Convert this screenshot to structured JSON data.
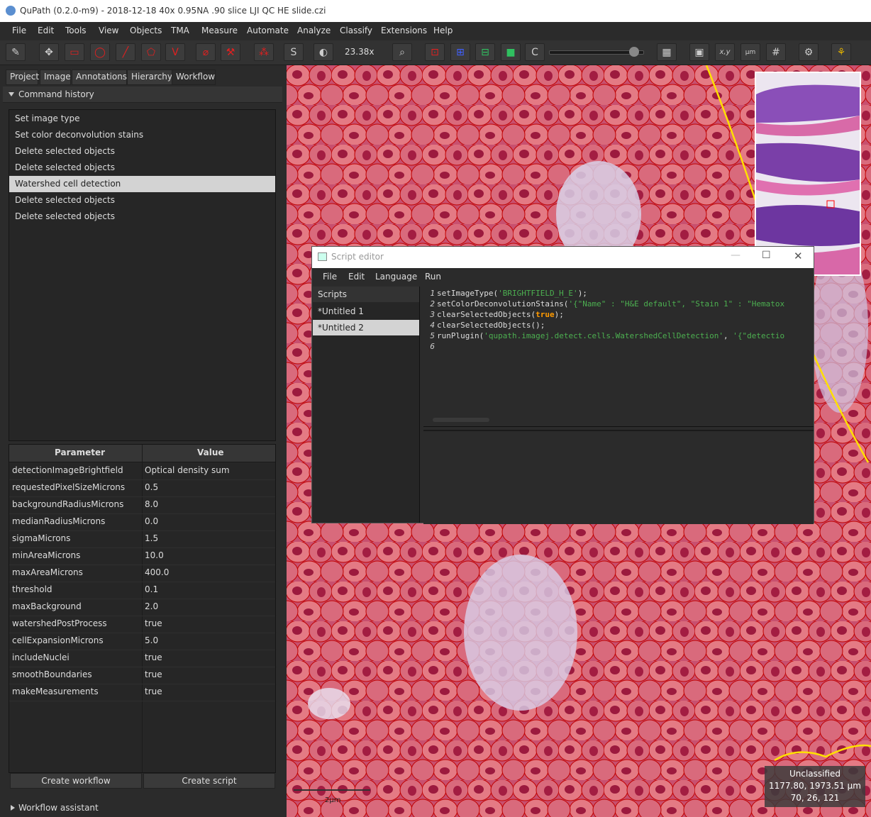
{
  "window": {
    "title": "QuPath (0.2.0-m9) - 2018-12-18 40x 0.95NA .90 slice LJI QC HE slide.czi"
  },
  "menu": [
    "File",
    "Edit",
    "Tools",
    "View",
    "Objects",
    "TMA",
    "Measure",
    "Automate",
    "Analyze",
    "Classify",
    "Extensions",
    "Help"
  ],
  "toolbar": {
    "zoom": "23.38x",
    "s_label": "S",
    "c_label": "C",
    "xy_label": "x,y",
    "um_label": "µm"
  },
  "tabs": [
    "Project",
    "Image",
    "Annotations",
    "Hierarchy",
    "Workflow"
  ],
  "command_history": {
    "label": "Command history",
    "items": [
      "Set image type",
      "Set color deconvolution stains",
      "Delete selected objects",
      "Delete selected objects",
      "Watershed cell detection",
      "Delete selected objects",
      "Delete selected objects"
    ],
    "selected_index": 4
  },
  "params": {
    "header_param": "Parameter",
    "header_value": "Value",
    "rows": [
      [
        "detectionImageBrightfield",
        "Optical density sum"
      ],
      [
        "requestedPixelSizeMicrons",
        "0.5"
      ],
      [
        "backgroundRadiusMicrons",
        "8.0"
      ],
      [
        "medianRadiusMicrons",
        "0.0"
      ],
      [
        "sigmaMicrons",
        "1.5"
      ],
      [
        "minAreaMicrons",
        "10.0"
      ],
      [
        "maxAreaMicrons",
        "400.0"
      ],
      [
        "threshold",
        "0.1"
      ],
      [
        "maxBackground",
        "2.0"
      ],
      [
        "watershedPostProcess",
        "true"
      ],
      [
        "cellExpansionMicrons",
        "5.0"
      ],
      [
        "includeNuclei",
        "true"
      ],
      [
        "smoothBoundaries",
        "true"
      ],
      [
        "makeMeasurements",
        "true"
      ]
    ]
  },
  "buttons": {
    "create_workflow": "Create workflow",
    "create_script": "Create script"
  },
  "workflow_assistant": "Workflow assistant",
  "viewer": {
    "scale_label": "2µm",
    "info_class": "Unclassified",
    "info_coords": "1177.80, 1973.51 µm",
    "info_rgb": "70, 26, 121"
  },
  "script_editor": {
    "title": "Script editor",
    "menu": [
      "File",
      "Edit",
      "Language",
      "Run"
    ],
    "scripts_header": "Scripts",
    "scripts": [
      "*Untitled 1",
      "*Untitled 2"
    ],
    "selected_script": 1,
    "code": [
      {
        "n": "1",
        "parts": [
          [
            "kw",
            "setImageType("
          ],
          [
            "str",
            "'BRIGHTFIELD_H_E'"
          ],
          [
            "kw",
            ");"
          ]
        ]
      },
      {
        "n": "2",
        "parts": [
          [
            "kw",
            "setColorDeconvolutionStains("
          ],
          [
            "str",
            "'{\"Name\" : \"H&E default\", \"Stain 1\" : \"Hematox"
          ]
        ]
      },
      {
        "n": "3",
        "parts": [
          [
            "kw",
            "clearSelectedObjects("
          ],
          [
            "tr",
            "true"
          ],
          [
            "kw",
            ");"
          ]
        ]
      },
      {
        "n": "4",
        "parts": [
          [
            "kw",
            "clearSelectedObjects();"
          ]
        ]
      },
      {
        "n": "5",
        "parts": [
          [
            "kw",
            "runPlugin("
          ],
          [
            "str",
            "'qupath.imagej.detect.cells.WatershedCellDetection'"
          ],
          [
            "kw",
            ", "
          ],
          [
            "str",
            "'{\"detectio"
          ]
        ]
      },
      {
        "n": "6",
        "parts": []
      }
    ]
  },
  "colors": {
    "accent_red": "#e02020",
    "selection": "#d3d3d3",
    "annotation_yellow": "#ffe000",
    "cell_outline": "#cc0000"
  }
}
